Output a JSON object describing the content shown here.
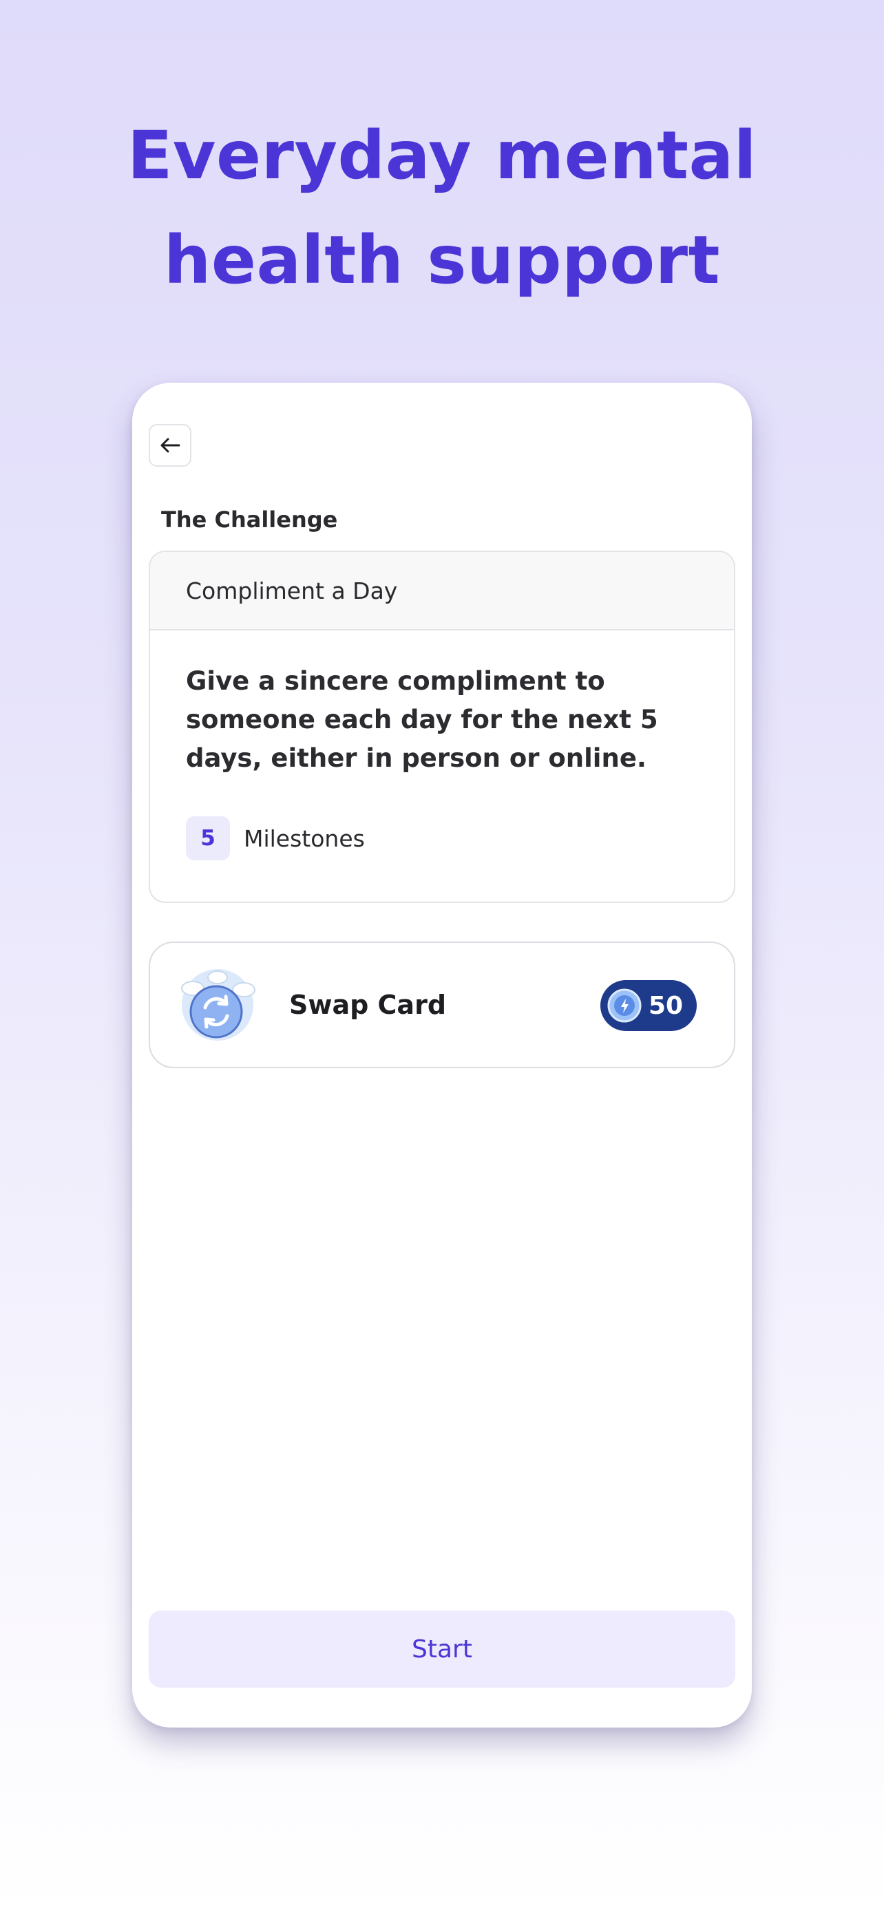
{
  "headline": {
    "line1": "Everyday mental",
    "line2": "health support"
  },
  "screen": {
    "back_icon": "arrow-left-icon",
    "section_title": "The Challenge",
    "challenge": {
      "title": "Compliment a Day",
      "description": "Give a sincere compliment to someone each day for the next 5 days, either in person or online.",
      "milestone_count": "5",
      "milestone_label": "Milestones"
    },
    "swap_card": {
      "icon": "swap-card-icon",
      "label": "Swap Card",
      "cost_icon": "coin-icon",
      "cost": "50"
    },
    "start_label": "Start"
  },
  "colors": {
    "accent": "#4b35d6",
    "accent_soft": "#edebfd",
    "cost_pill": "#1e3a8a",
    "background_top": "#dfdbfa"
  }
}
